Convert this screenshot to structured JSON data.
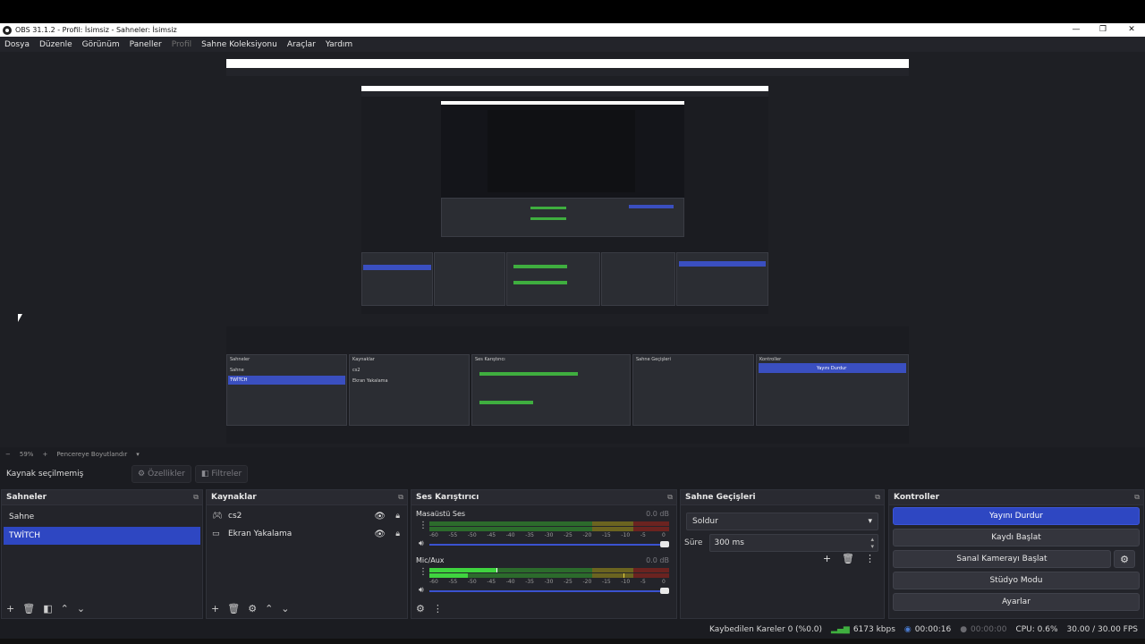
{
  "window": {
    "title": "OBS 31.1.2 - Profil: İsimsiz - Sahneler: İsimsiz",
    "minimize": "—",
    "maximize": "❐",
    "close": "✕"
  },
  "menu": [
    "Dosya",
    "Düzenle",
    "Görünüm",
    "Paneller",
    "Profil",
    "Sahne Koleksiyonu",
    "Araçlar",
    "Yardım"
  ],
  "zoom": {
    "minus": "−",
    "value": "59%",
    "plus": "+",
    "fit_label": "Pencereye Boyutlandır",
    "dropdown": "▾"
  },
  "source_toolbar": {
    "no_source": "Kaynak seçilmemiş",
    "properties": "Özellikler",
    "filters": "Filtreler"
  },
  "scenes": {
    "title": "Sahneler",
    "items": [
      "Sahne",
      "TWİTCH"
    ],
    "selected_index": 1
  },
  "sources": {
    "title": "Kaynaklar",
    "items": [
      {
        "name": "cs2",
        "icon": "gamepad-icon"
      },
      {
        "name": "Ekran Yakalama",
        "icon": "monitor-icon"
      }
    ]
  },
  "mixer": {
    "title": "Ses Karıştırıcı",
    "scale": [
      "-60",
      "-55",
      "-50",
      "-45",
      "-40",
      "-35",
      "-30",
      "-25",
      "-20",
      "-15",
      "-10",
      "-5",
      "0"
    ],
    "channels": [
      {
        "name": "Masaüstü Ses",
        "db": "0.0 dB",
        "level": 0.0
      },
      {
        "name": "Mic/Aux",
        "db": "0.0 dB",
        "level": 0.28
      }
    ]
  },
  "transitions": {
    "title": "Sahne Geçişleri",
    "selected": "Soldur",
    "duration_label": "Süre",
    "duration_value": "300 ms"
  },
  "controls": {
    "title": "Kontroller",
    "stop_stream": "Yayını Durdur",
    "start_record": "Kaydı Başlat",
    "virtual_cam": "Sanal Kamerayı Başlat",
    "studio_mode": "Stüdyo Modu",
    "settings": "Ayarlar"
  },
  "status": {
    "dropped_frames": "Kaybedilen Kareler 0 (%0.0)",
    "bitrate": "6173 kbps",
    "stream_time": "00:00:16",
    "record_time": "00:00:00",
    "cpu": "CPU: 0.6%",
    "fps": "30.00 / 30.00 FPS"
  },
  "colors": {
    "accent": "#2e47c2",
    "meter_green": "#3fae3f",
    "meter_yellow": "#c9b52a",
    "meter_red": "#c0352f",
    "background": "#1b1c21"
  }
}
